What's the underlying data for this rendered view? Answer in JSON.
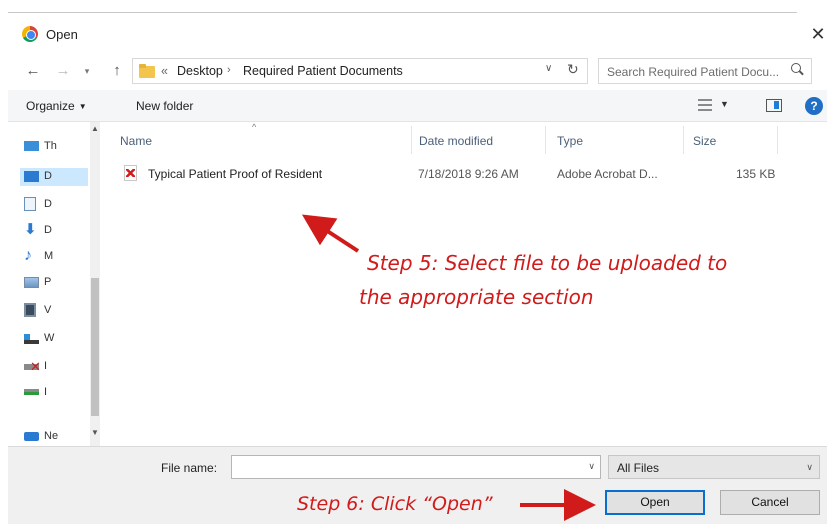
{
  "window": {
    "title": "Open",
    "close_glyph": "✕"
  },
  "address": {
    "overflow_glyph": "«",
    "crumbs": [
      "Desktop",
      "Required Patient Documents"
    ],
    "search_placeholder": "Search Required Patient Docu..."
  },
  "toolbar": {
    "organize_label": "Organize",
    "new_folder_label": "New folder"
  },
  "navpane": {
    "items": [
      {
        "label": "Th",
        "icon": "computer-icon"
      },
      {
        "label": "D",
        "icon": "desktop-icon"
      },
      {
        "label": "D",
        "icon": "documents-icon"
      },
      {
        "label": "D",
        "icon": "downloads-icon"
      },
      {
        "label": "M",
        "icon": "music-icon"
      },
      {
        "label": "P",
        "icon": "pictures-icon"
      },
      {
        "label": "V",
        "icon": "videos-icon"
      },
      {
        "label": "W",
        "icon": "drive-icon"
      },
      {
        "label": "I",
        "icon": "disconnected-drive-icon"
      },
      {
        "label": "I",
        "icon": "network-drive-icon"
      },
      {
        "label": "Ne",
        "icon": "network-icon"
      }
    ]
  },
  "filelist": {
    "columns": [
      "Name",
      "Date modified",
      "Type",
      "Size"
    ],
    "rows": [
      {
        "name": "Typical Patient Proof of Resident",
        "date_modified": "7/18/2018 9:26 AM",
        "type": "Adobe Acrobat D...",
        "size": "135 KB",
        "icon": "pdf-icon"
      }
    ]
  },
  "bottom": {
    "file_name_label": "File name:",
    "file_name_value": "",
    "filter_label": "All Files",
    "open_label": "Open",
    "cancel_label": "Cancel"
  },
  "annotations": {
    "step5_line1": "Step 5: Select file to be uploaded to",
    "step5_line2": "the appropriate section",
    "step6": "Step 6: Click “Open”"
  },
  "colors": {
    "annotation_red": "#d11a1a",
    "accent_blue": "#0a6ed1",
    "selection_blue": "#cce8ff"
  }
}
